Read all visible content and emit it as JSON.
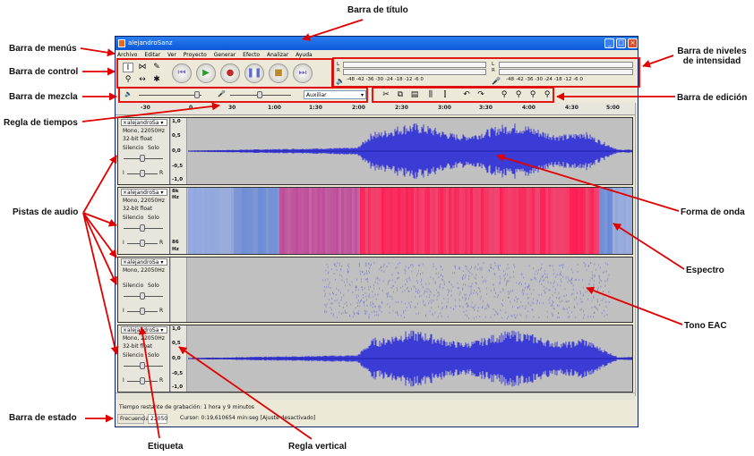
{
  "annotations": {
    "barra_titulo": "Barra de título",
    "barra_menus": "Barra de menús",
    "barra_control": "Barra de control",
    "barra_niveles": "Barra de niveles\nde intensidad",
    "barra_mezcla": "Barra de mezcla",
    "barra_edicion": "Barra de edición",
    "regla_tiempos": "Regla de tiempos",
    "pistas_audio": "Pistas de audio",
    "forma_onda": "Forma de onda",
    "espectro": "Espectro",
    "tono_eac": "Tono EAC",
    "barra_estado": "Barra de estado",
    "etiqueta": "Etiqueta",
    "regla_vertical": "Regla vertical"
  },
  "window": {
    "title": "alejandroSanz",
    "menus": [
      "Archivo",
      "Editar",
      "Ver",
      "Proyecto",
      "Generar",
      "Efecto",
      "Analizar",
      "Ayuda"
    ]
  },
  "meters": {
    "scale": "-48  -42  -36  -30  -24  -18  -12  -6  0",
    "l": "L",
    "r": "R"
  },
  "mixer": {
    "input_source": "Auxiliar"
  },
  "ruler": {
    "ticks": [
      "-30",
      "0",
      "30",
      "1:00",
      "1:30",
      "2:00",
      "2:30",
      "3:00",
      "3:30",
      "4:00",
      "4:30",
      "5:00"
    ]
  },
  "tracks": [
    {
      "name": "alejandroSa",
      "line1": "Mono, 22050Hz",
      "line2": "32-bit float",
      "mute": "Silencio",
      "solo": "Solo",
      "l": "I",
      "r": "R",
      "v": [
        "1,0",
        "0,5",
        "0,0",
        "-0,5",
        "-1,0"
      ]
    },
    {
      "name": "alejandroSa",
      "line1": "Mono, 22050Hz",
      "line2": "32-bit float",
      "mute": "Silencio",
      "solo": "Solo",
      "l": "I",
      "r": "R",
      "v": [
        "8k",
        "Hz",
        "86",
        "Hz"
      ]
    },
    {
      "name": "alejandroSa",
      "line1": "Mono, 22050Hz",
      "mute": "Silencio",
      "solo": "Solo",
      "l": "I",
      "r": "R"
    },
    {
      "name": "alejandroSa",
      "line1": "Mono, 22050Hz",
      "line2": "32-bit float",
      "mute": "Silencio",
      "solo": "Solo",
      "l": "I",
      "r": "R",
      "v": [
        "1,0",
        "0,5",
        "0,0",
        "-0,5",
        "-1,0"
      ]
    }
  ],
  "status": {
    "message": "Tiempo restante de grabación: 1 hora y 9 minutos",
    "frequency_label": "Frecuencia",
    "frequency_value": "22050",
    "cursor": "Cursor: 0:19,610654 min:seg   [Ajuste desactivado]"
  },
  "colors": {
    "waveform": "#3b3bd6",
    "spectrum_hot": "#ff1e55",
    "spectrum_cool": "#6a8ad8",
    "track_bg": "#c0c0c0",
    "arrow": "#e00000"
  }
}
